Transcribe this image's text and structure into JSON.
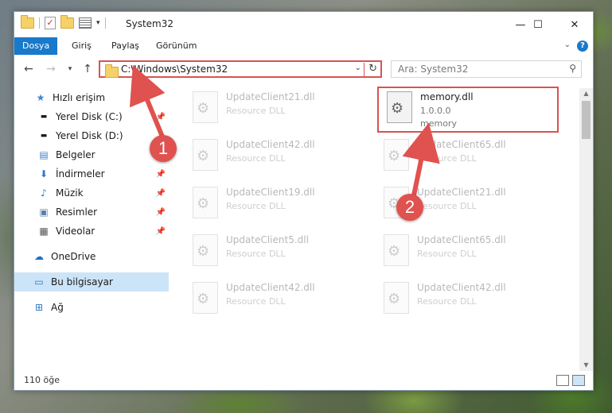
{
  "window": {
    "title": "System32",
    "controls": {
      "minimize": "—",
      "maximize": "☐",
      "close": "✕"
    }
  },
  "ribbon": {
    "tabs": [
      {
        "label": "Dosya",
        "active": true
      },
      {
        "label": "Giriş"
      },
      {
        "label": "Paylaş"
      },
      {
        "label": "Görünüm"
      }
    ],
    "help": "?"
  },
  "address": {
    "path": "C:\\Windows\\System32",
    "search_placeholder": "Ara: System32"
  },
  "sidebar": {
    "items": [
      {
        "label": "Hızlı erişim",
        "icon": "star-icon",
        "pinned": false
      },
      {
        "label": "Yerel Disk (C:)",
        "icon": "drive-icon",
        "pinned": true
      },
      {
        "label": "Yerel Disk (D:)",
        "icon": "drive-icon",
        "pinned": false
      },
      {
        "label": "Belgeler",
        "icon": "document-icon",
        "pinned": false
      },
      {
        "label": "İndirmeler",
        "icon": "download-icon",
        "pinned": true
      },
      {
        "label": "Müzik",
        "icon": "music-icon",
        "pinned": true
      },
      {
        "label": "Resimler",
        "icon": "pictures-icon",
        "pinned": true
      },
      {
        "label": "Videolar",
        "icon": "video-icon",
        "pinned": true
      },
      {
        "label": "OneDrive",
        "icon": "cloud-icon",
        "pinned": false
      },
      {
        "label": "Bu bilgisayar",
        "icon": "computer-icon",
        "pinned": false,
        "selected": true
      },
      {
        "label": "Ağ",
        "icon": "network-icon",
        "pinned": false
      }
    ]
  },
  "files": [
    {
      "name": "UpdateClient21.dll",
      "desc": "Resource DLL"
    },
    {
      "name": "memory.dll",
      "version": "1.0.0.0",
      "desc": "memory",
      "highlighted": true
    },
    {
      "name": "UpdateClient42.dll",
      "desc": "Resource DLL"
    },
    {
      "name": "UpdateClient65.dll",
      "desc": "Resource DLL"
    },
    {
      "name": "UpdateClient19.dll",
      "desc": "Resource DLL"
    },
    {
      "name": "UpdateClient21.dll",
      "desc": "Resource DLL"
    },
    {
      "name": "UpdateClient5.dll",
      "desc": "Resource DLL"
    },
    {
      "name": "UpdateClient65.dll",
      "desc": "Resource DLL"
    },
    {
      "name": "UpdateClient42.dll",
      "desc": "Resource DLL"
    },
    {
      "name": "UpdateClient42.dll",
      "desc": "Resource DLL"
    }
  ],
  "status": {
    "count": "110 öğe"
  },
  "callouts": [
    "1",
    "2"
  ],
  "colors": {
    "accent": "#1979ca",
    "highlight": "#d9534f"
  }
}
